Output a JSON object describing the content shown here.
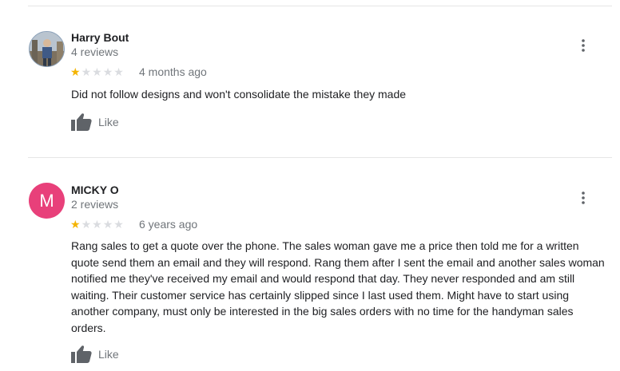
{
  "reviews": [
    {
      "name": "Harry Bout",
      "review_count": "4 reviews",
      "rating": 1,
      "max_rating": 5,
      "time": "4 months ago",
      "text": "Did not follow designs and won't consolidate the mistake they made",
      "like_label": "Like",
      "avatar_type": "photo"
    },
    {
      "name": "MICKY O",
      "review_count": "2 reviews",
      "rating": 1,
      "max_rating": 5,
      "time": "6 years ago",
      "text": "Rang sales to get a quote over the phone. The sales woman gave me a price then told me for a written quote send them an email and they will respond. Rang them after I sent the email and another sales woman notified me they've received my email and would respond that day. They never responded and am still waiting.  Their customer service has certainly slipped since I last used them. Might have to start using another company, must only be interested in the big sales orders with no time for the handyman sales orders.",
      "like_label": "Like",
      "avatar_type": "letter",
      "avatar_letter": "M",
      "avatar_color": "#e8407a"
    }
  ],
  "colors": {
    "star_filled": "#f4b400",
    "star_empty": "#dadce0",
    "secondary_text": "#70757a",
    "icon_gray": "#5f6368"
  },
  "icons": {
    "like": "thumbs-up-icon",
    "more": "more-vert-icon",
    "star": "star-icon"
  }
}
